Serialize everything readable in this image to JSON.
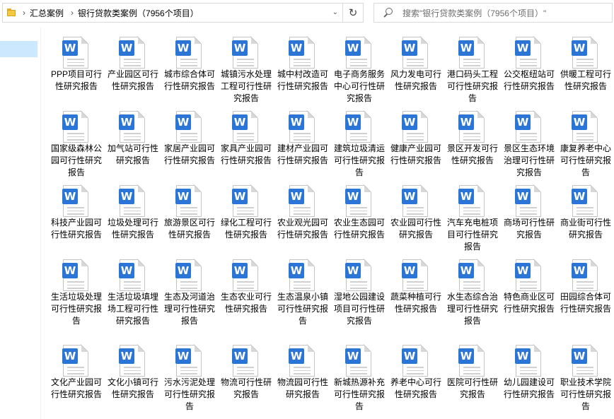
{
  "address": {
    "crumbs": [
      "汇总案例",
      "银行贷款类案例（7956个项目）"
    ]
  },
  "search": {
    "placeholder": "搜索\"银行贷款类案例（7956个项目）\""
  },
  "icons": {
    "folder": "folder-icon",
    "doc": "word-document-icon",
    "refresh": "refresh-icon",
    "search": "search-icon",
    "chevron": "chevron-right-icon",
    "dropdown": "chevron-down-icon"
  },
  "colors": {
    "word_badge": "#2b75d6",
    "nav_selected": "#cce8ff"
  },
  "files": [
    "PPP项目可行性研究报告",
    "产业园区可行性研究报告",
    "城市综合体可行性研究报告",
    "城镇污水处理工程可行性研究报告",
    "城中村改造可行性研究报告",
    "电子商务服务中心可行性研究报告",
    "风力发电可行性研究报告",
    "港口码头工程可行性研究报告",
    "公交枢纽站可行性研究报告",
    "供暖工程可行性研究报告",
    "国家级森林公园可行性研究报告",
    "加气站可行性研究报告",
    "家居产业园可行性研究报告",
    "家具产业园可行性研究报告",
    "建材产业园可行性研究报告",
    "建筑垃圾清运可行性研究报告",
    "健康产业园可行性研究报告",
    "景区开发可行性研究报告",
    "景区生态环境治理可行性研究报告",
    "康复养老中心可行性研究报告",
    "科技产业园可行性研究报告",
    "垃圾处理可行性研究报告",
    "旅游景区可行性研究报告",
    "绿化工程可行性研究报告",
    "农业观光园可行性研究报告",
    "农业生态园可行性研究报告",
    "农业园可行性研究报告",
    "汽车充电桩项目可行性研究报告",
    "商场可行性研究报告",
    "商业街可行性研究报告",
    "生活垃圾处理可行性研究报告",
    "生活垃圾填埋场工程可行性研究报告",
    "生态及河道治理可行性研究报告",
    "生态农业可行性研究报告",
    "生态温泉小镇可行性研究报告",
    "湿地公园建设项目可行性研究报告",
    "蔬菜种植可行性研究报告",
    "水生态综合治理可行性研究报告",
    "特色商业区可行性研究报告",
    "田园综合体可行性研究报告",
    "文化产业园可行性研究报告",
    "文化小镇可行性研究报告",
    "污水污泥处理可行性研究报告",
    "物流可行性研究报告",
    "物流园可行性研究报告",
    "新城热源补充可行性研究报告",
    "养老中心可行性研究报告",
    "医院可行性研究报告",
    "幼儿园建设可行性研究报告",
    "职业技术学院可行性研究报告"
  ]
}
